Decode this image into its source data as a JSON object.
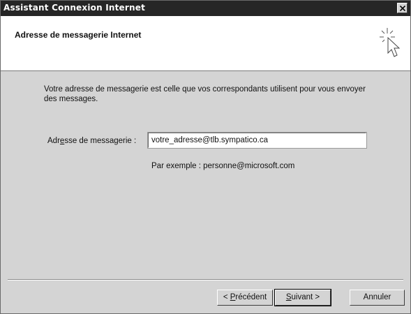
{
  "window": {
    "title": "Assistant Connexion Internet",
    "close_label": "×"
  },
  "header": {
    "title": "Adresse de messagerie Internet",
    "icon": "wizard-cursor-sparkle-icon"
  },
  "content": {
    "intro": "Votre adresse de messagerie est celle que vos correspondants utilisent pour vous envoyer des messages.",
    "field": {
      "label_pre": "Adr",
      "label_accel": "e",
      "label_post": "sse de messagerie :",
      "value": "votre_adresse@tlb.sympatico.ca"
    },
    "example": "Par exemple : personne@microsoft.com"
  },
  "buttons": {
    "prev_pre": "< ",
    "prev_accel": "P",
    "prev_post": "récédent",
    "next_accel": "S",
    "next_post": "uivant >",
    "cancel": "Annuler"
  },
  "colors": {
    "titlebar": "#262626",
    "dialog_bg": "#d4d4d4",
    "header_bg": "#ffffff"
  }
}
